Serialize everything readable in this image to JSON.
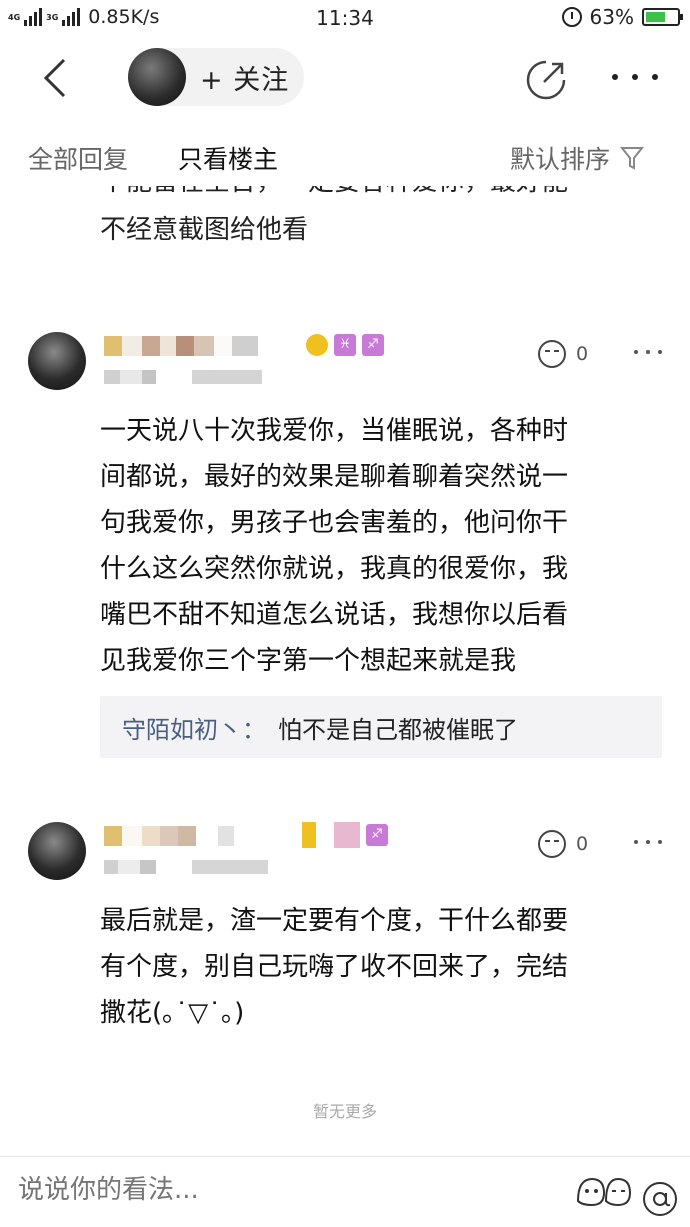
{
  "status_bar": {
    "network_top": "4G",
    "network_top2": "4G",
    "network_mid": "3G",
    "speed": "0.85K/s",
    "time": "11:34",
    "battery_percent": "63%",
    "battery_level": 0.63
  },
  "header": {
    "follow_label": "+ 关注"
  },
  "tabs": {
    "all_replies": "全部回复",
    "op_only": "只看楼主",
    "sort_label": "默认排序"
  },
  "previous_post": {
    "clipped_line": "不能留在空台，一定要各种爱你，最好能",
    "last_line": "不经意截图给他看"
  },
  "comments": [
    {
      "likes": "0",
      "text_lines": [
        "一天说八十次我爱你，当催眠说，各种时",
        "间都说，最好的效果是聊着聊着突然说一",
        "句我爱你，男孩子也会害羞的，他问你干",
        "什么这么突然你就说，我真的很爱你，我",
        "嘴巴不甜不知道怎么说话，我想你以后看",
        "见我爱你三个字第一个想起来就是我"
      ],
      "reply": {
        "user": "守陌如初丶：",
        "text": "怕不是自己都被催眠了"
      }
    },
    {
      "likes": "0",
      "text_lines": [
        "最后就是，渣一定要有个度，干什么都要",
        "有个度，别自己玩嗨了收不回来了，完结",
        "撒花(｡˙▽˙｡)"
      ]
    }
  ],
  "footer": {
    "no_more": "暂无更多",
    "input_placeholder": "说说你的看法..."
  },
  "colors": {
    "reply_user": "#4a5f80",
    "level_badge": "#f0c020",
    "zodiac_badge": "#c77bd6"
  }
}
